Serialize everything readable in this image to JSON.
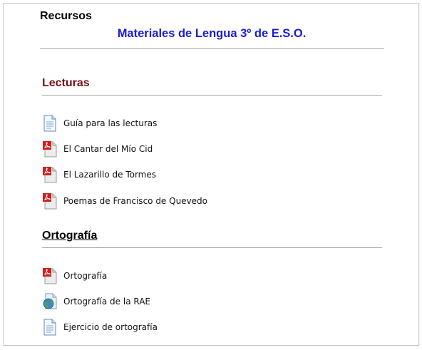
{
  "header": {
    "title": "Recursos",
    "subtitle": "Materiales de Lengua 3º de E.S.O.",
    "subtitle_color": "#1a1ad6"
  },
  "colors": {
    "section_red": "#7a0d0d",
    "section_black": "#000000"
  },
  "sections": [
    {
      "title": "Lecturas",
      "items": [
        {
          "label": "Guía para las lecturas",
          "icon": "document-icon"
        },
        {
          "label": "El Cantar del Mío Cid",
          "icon": "pdf-icon"
        },
        {
          "label": "El Lazarillo de Tormes",
          "icon": "pdf-icon"
        },
        {
          "label": "Poemas de Francisco de Quevedo",
          "icon": "pdf-icon"
        }
      ]
    },
    {
      "title": "Ortografía",
      "items": [
        {
          "label": "Ortografía",
          "icon": "pdf-icon"
        },
        {
          "label": "Ortografía de la RAE",
          "icon": "web-link-icon"
        },
        {
          "label": "Ejercicio de ortografía",
          "icon": "document-icon"
        }
      ]
    }
  ]
}
